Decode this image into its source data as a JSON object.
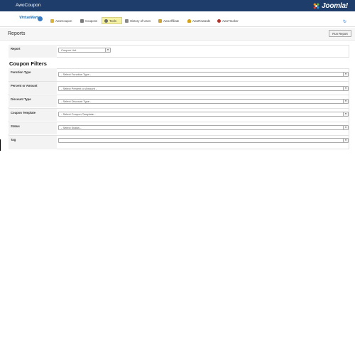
{
  "app": {
    "title": "AwoCoupon",
    "brand": "Joomla!"
  },
  "nav": {
    "vm_logo": "VirtueMart",
    "items": [
      {
        "label": "AwoCoupon",
        "icon": "awocoupon-icon",
        "color": "#d8b23a",
        "active": false
      },
      {
        "label": "Coupons",
        "icon": "coupons-icon",
        "color": "#7a7a7a",
        "active": false
      },
      {
        "label": "Tools",
        "icon": "tools-icon",
        "color": "#6b6b6b",
        "active": true
      },
      {
        "label": "History of Uses",
        "icon": "history-icon",
        "color": "#888888",
        "active": false
      },
      {
        "label": "AwoAffiliate",
        "icon": "awoaffiliate-icon",
        "color": "#c9a43b",
        "active": false
      },
      {
        "label": "AwoRewards",
        "icon": "aworewards-icon",
        "color": "#d4a019",
        "active": false
      },
      {
        "label": "AwoTracker",
        "icon": "awotracker-icon",
        "color": "#b2332c",
        "active": false
      }
    ]
  },
  "page": {
    "title": "Reports",
    "run_report_label": "Run Report"
  },
  "report": {
    "label": "Report",
    "value": "Coupon List"
  },
  "filters": {
    "title": "Coupon Filters",
    "rows": [
      {
        "label": "Function Type",
        "value": "- Select Function Type -"
      },
      {
        "label": "Percent or Amount",
        "value": "- Select Percent or Amount -"
      },
      {
        "label": "Discount Type",
        "value": "- Select Discount Type -"
      },
      {
        "label": "Coupon Template",
        "value": "- Select Coupon Template -"
      },
      {
        "label": "Status",
        "value": "- Select Status -"
      },
      {
        "label": "Tag",
        "value": ""
      }
    ]
  },
  "colors": {
    "topbar": "#1f3d6a",
    "active_tab": "#f5f1a2",
    "link": "#1f6fb5"
  }
}
